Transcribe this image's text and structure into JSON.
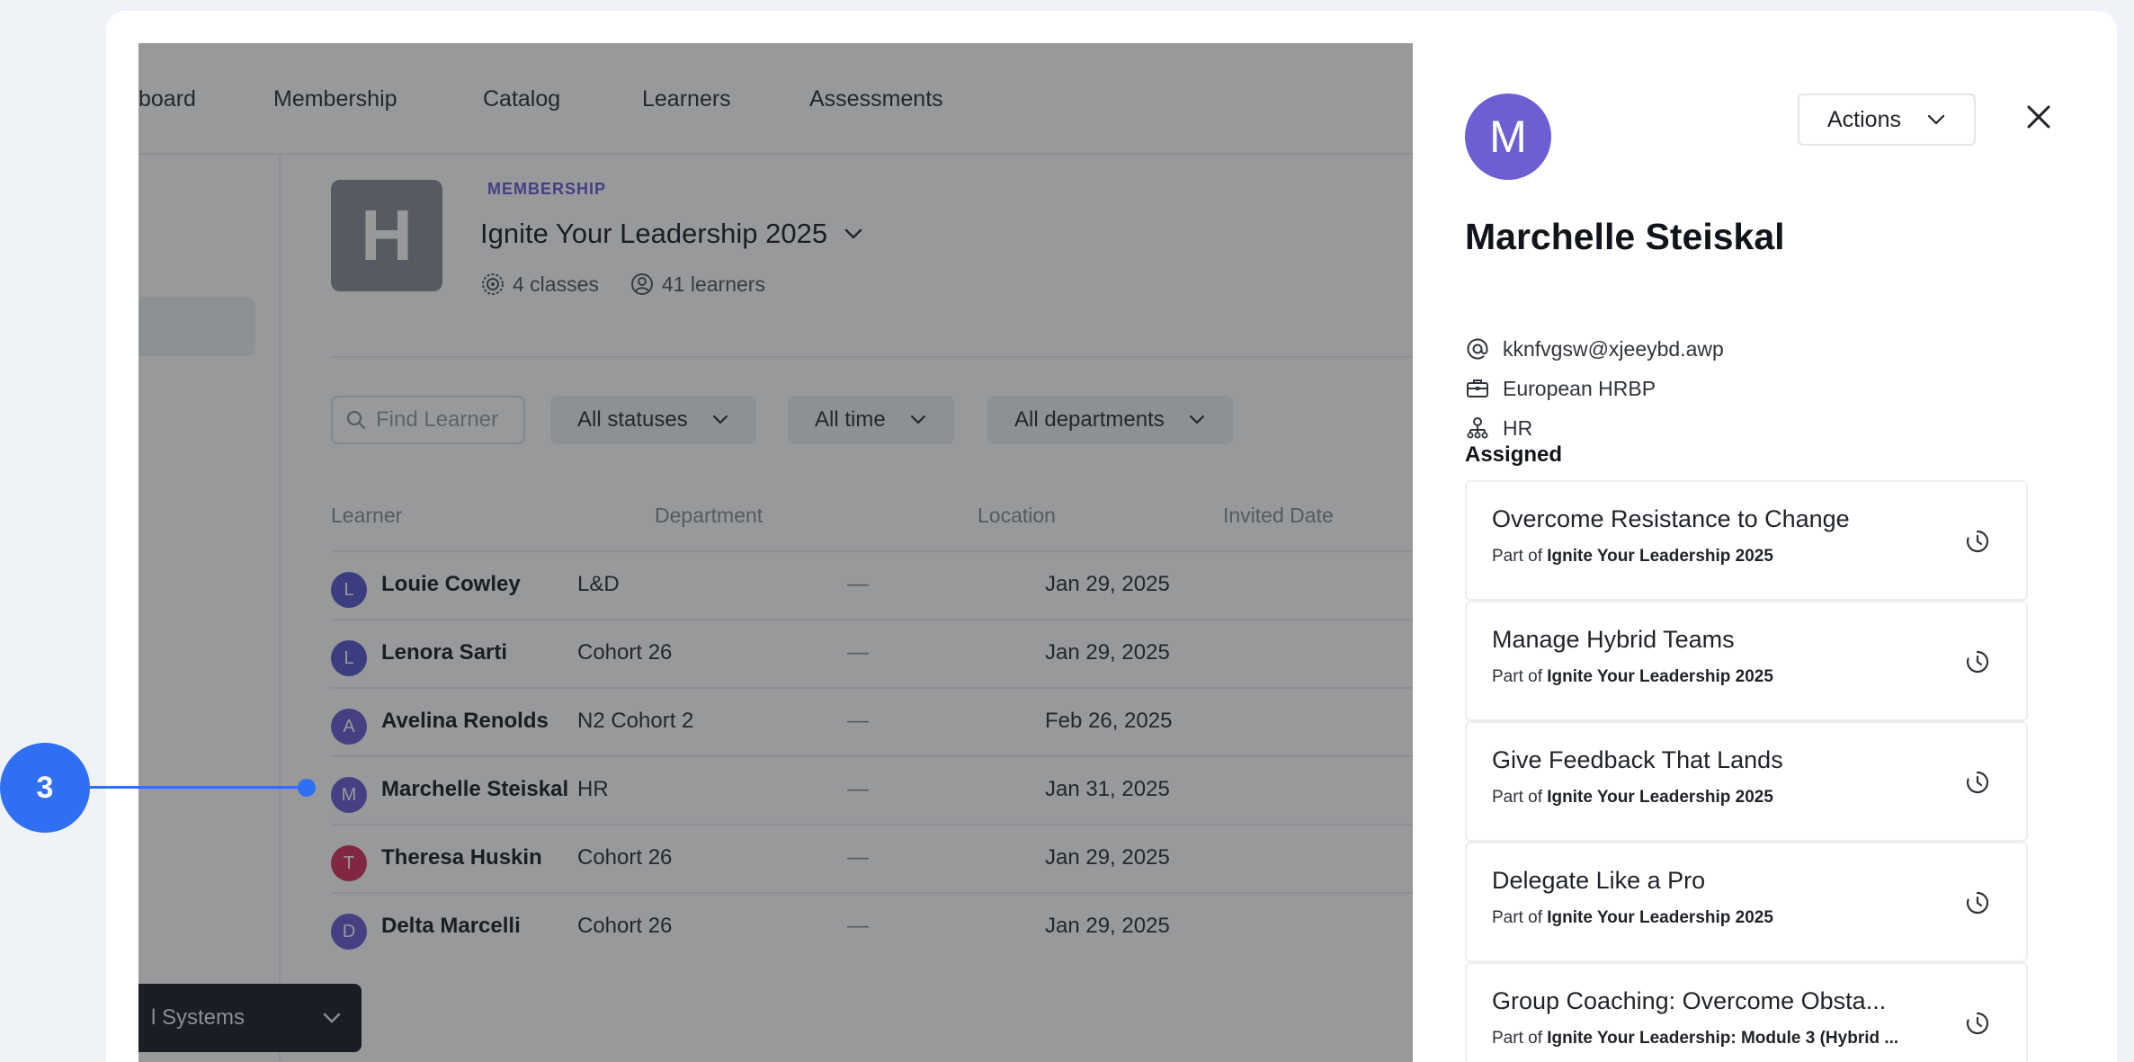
{
  "nav": {
    "items": [
      "board",
      "Membership",
      "Catalog",
      "Learners",
      "Assessments"
    ]
  },
  "program": {
    "tile_letter": "H",
    "kicker": "MEMBERSHIP",
    "title": "Ignite Your Leadership 2025",
    "classes": "4 classes",
    "learners": "41 learners"
  },
  "filters": {
    "search_placeholder": "Find Learner",
    "status": "All statuses",
    "time": "All time",
    "department": "All departments"
  },
  "table": {
    "headers": {
      "learner": "Learner",
      "department": "Department",
      "location": "Location",
      "invited": "Invited Date"
    },
    "rows": [
      {
        "initial": "L",
        "name": "Louie Cowley",
        "department": "L&D",
        "location": "—",
        "invited": "Jan 29, 2025",
        "color": "#5b5ccc"
      },
      {
        "initial": "L",
        "name": "Lenora Sarti",
        "department": "Cohort 26",
        "location": "—",
        "invited": "Jan 29, 2025",
        "color": "#5b5ccc"
      },
      {
        "initial": "A",
        "name": "Avelina Renolds",
        "department": "N2 Cohort 2",
        "location": "—",
        "invited": "Feb 26, 2025",
        "color": "#6d5fd3"
      },
      {
        "initial": "M",
        "name": "Marchelle Steiskal",
        "department": "HR",
        "location": "—",
        "invited": "Jan 31, 2025",
        "color": "#6d5fd3"
      },
      {
        "initial": "T",
        "name": "Theresa Huskin",
        "department": "Cohort 26",
        "location": "—",
        "invited": "Jan 29, 2025",
        "color": "#d8345f"
      },
      {
        "initial": "D",
        "name": "Delta Marcelli",
        "department": "Cohort 26",
        "location": "—",
        "invited": "Jan 29, 2025",
        "color": "#6d5fd3"
      }
    ]
  },
  "org_selector": {
    "label": "l Systems"
  },
  "panel": {
    "avatar_initial": "M",
    "actions_label": "Actions",
    "name": "Marchelle Steiskal",
    "email": "kknfvgsw@xjeeybd.awp",
    "title": "European HRBP",
    "department": "HR",
    "assigned_label": "Assigned",
    "part_of_prefix": "Part of",
    "assigned": [
      {
        "title": "Overcome Resistance to Change",
        "program": "Ignite Your Leadership 2025"
      },
      {
        "title": "Manage Hybrid Teams",
        "program": "Ignite Your Leadership 2025"
      },
      {
        "title": "Give Feedback That Lands",
        "program": "Ignite Your Leadership 2025"
      },
      {
        "title": "Delegate Like a Pro",
        "program": "Ignite Your Leadership 2025"
      },
      {
        "title": "Group Coaching: Overcome Obsta...",
        "program": "Ignite Your Leadership: Module 3 (Hybrid ..."
      }
    ]
  },
  "annotation": {
    "step_number": "3"
  },
  "colors": {
    "accent_blue": "#2f6ff2",
    "avatar_purple": "#6d5fd3"
  }
}
